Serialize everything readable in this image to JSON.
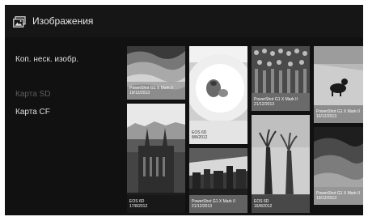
{
  "header": {
    "title": "Изображения",
    "icon": "gallery-icon"
  },
  "sidebar": {
    "copy_multiple": "Коп. неск. изобр.",
    "card_sd": "Карта SD",
    "card_cf": "Карта CF"
  },
  "photos": [
    {
      "camera": "PowerShot G1 X Mark II",
      "date": "19/12/2013",
      "subject": "sand-dunes"
    },
    {
      "camera": "EOS 6D",
      "date": "17/8/2012",
      "subject": "city-cathedral"
    },
    {
      "camera": "EOS 6D",
      "date": "8/8/2012",
      "subject": "dessert-plate"
    },
    {
      "camera": "PowerShot G1 X Mark II",
      "date": "21/12/2013",
      "subject": "city-skyline"
    },
    {
      "camera": "PowerShot G1 X Mark II",
      "date": "21/12/2013",
      "subject": "market-stall"
    },
    {
      "camera": "EOS 6D",
      "date": "16/8/2012",
      "subject": "baobab-trees"
    },
    {
      "camera": "PowerShot G1 X Mark II",
      "date": "16/12/2013",
      "subject": "dog-on-pavement"
    },
    {
      "camera": "PowerShot G1 X Mark II",
      "date": "19/12/2013",
      "subject": "desert-dunes"
    }
  ]
}
